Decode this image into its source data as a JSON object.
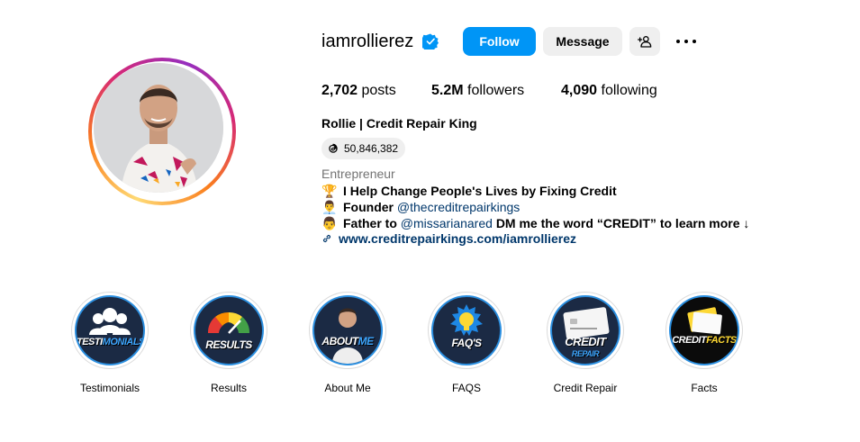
{
  "profile": {
    "username": "iamrollierez",
    "follow_label": "Follow",
    "message_label": "Message",
    "stats": {
      "posts_count": "2,702",
      "posts_label": "posts",
      "followers_count": "5.2M",
      "followers_label": "followers",
      "following_count": "4,090",
      "following_label": "following"
    },
    "full_name": "Rollie | Credit Repair King",
    "threads_count": "50,846,382",
    "category": "Entrepreneur",
    "bio": {
      "line1_emoji": "🏆",
      "line1_text": "I Help Change People's Lives by Fixing Credit",
      "line2_emoji": "👨‍💼",
      "line2_text": "Founder",
      "line2_mention": "@thecreditrepairkings",
      "line3_emoji": "👨",
      "line3_text": "Father to",
      "line3_mention": "@missarianared",
      "line3_cta": "DM me the word “CREDIT” to learn more ↓"
    },
    "website": "www.creditrepairkings.com/iamrollierez"
  },
  "icons": {
    "verified": "verified-badge-icon",
    "add_user": "add-user-icon",
    "more": "more-options-icon",
    "threads": "threads-icon",
    "link": "link-icon"
  },
  "colors": {
    "primary": "#0095f6",
    "secondary_button": "#efefef",
    "link": "#00376b",
    "muted": "#737373",
    "highlight_bg": "#1b2a44"
  },
  "highlights": [
    {
      "label": "Testimonials",
      "cover_text_a": "TESTI",
      "cover_text_b": "MONIALS"
    },
    {
      "label": "Results",
      "cover_text_a": "RESULTS",
      "cover_text_b": ""
    },
    {
      "label": "About Me",
      "cover_text_a": "ABOUT",
      "cover_text_b": "ME"
    },
    {
      "label": "FAQS",
      "cover_text_a": "FAQ'S",
      "cover_text_b": ""
    },
    {
      "label": "Credit Repair",
      "cover_text_a": "CREDIT",
      "cover_text_b": "REPAIR"
    },
    {
      "label": "Facts",
      "cover_text_a": "CREDIT",
      "cover_text_b": "FACTS"
    }
  ]
}
